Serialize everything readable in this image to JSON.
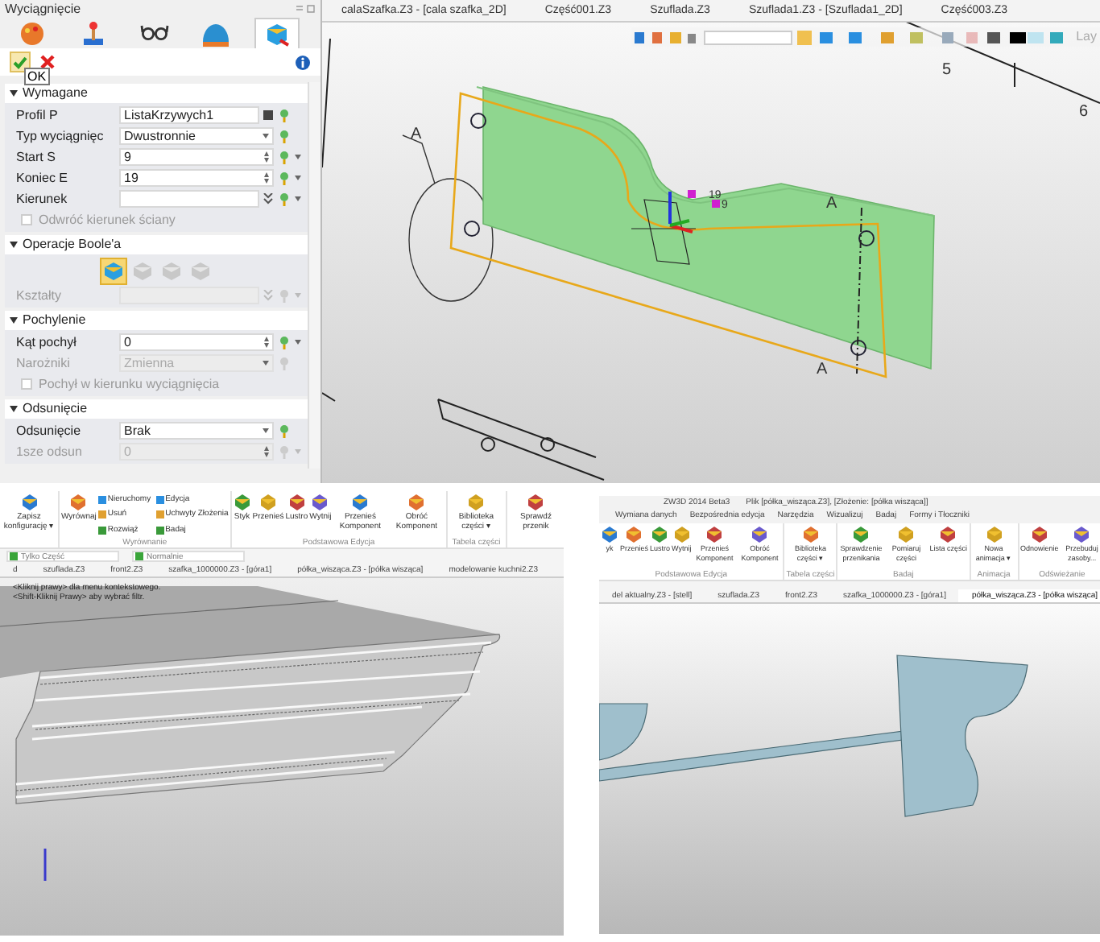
{
  "properties_panel": {
    "title": "Wyciągnięcie",
    "tabs": [
      {
        "kind": "palette",
        "selected": false
      },
      {
        "kind": "joystick",
        "selected": false
      },
      {
        "kind": "glasses",
        "selected": false
      },
      {
        "kind": "dome",
        "selected": false
      },
      {
        "kind": "cube",
        "selected": true
      }
    ],
    "tooltip": "OK",
    "sections": [
      {
        "title": "Wymagane",
        "expanded": true,
        "rows": [
          {
            "kind": "text",
            "label": "Profil P",
            "value": "ListaKrzywych1",
            "disabled": false
          },
          {
            "kind": "dropdown",
            "label": "Typ wyciągnięc",
            "value": "Dwustronnie",
            "disabled": false
          },
          {
            "kind": "spin",
            "label": "Start S",
            "value": "9",
            "disabled": false
          },
          {
            "kind": "spin",
            "label": "Koniec E",
            "value": "19",
            "disabled": false
          },
          {
            "kind": "direction",
            "label": "Kierunek",
            "disabled": false
          },
          {
            "kind": "checkbox",
            "label": "Odwróć kierunek ściany",
            "checked": false,
            "disabled": true
          }
        ]
      },
      {
        "title": "Operacje Boole'a",
        "expanded": true,
        "rows": [
          {
            "kind": "booleans",
            "options": [
              {
                "selected": true
              },
              {
                "selected": false
              },
              {
                "selected": false
              },
              {
                "selected": false
              }
            ]
          },
          {
            "kind": "direction",
            "label": "Kształty",
            "disabled": true
          }
        ]
      },
      {
        "title": "Pochylenie",
        "expanded": true,
        "rows": [
          {
            "kind": "spin",
            "label": "Kąt pochył",
            "value": "0",
            "disabled": false
          },
          {
            "kind": "dropdown",
            "label": "Narożniki",
            "value": "Zmienna",
            "disabled": true
          },
          {
            "kind": "checkbox",
            "label": "Pochył w kierunku wyciągnięcia",
            "checked": false,
            "disabled": true
          }
        ]
      },
      {
        "title": "Odsunięcie",
        "expanded": true,
        "rows": [
          {
            "kind": "dropdown",
            "label": "Odsunięcie",
            "value": "Brak",
            "disabled": false
          },
          {
            "kind": "spin",
            "label": "1sze odsun",
            "value": "0",
            "disabled": true
          }
        ]
      }
    ]
  },
  "viewport": {
    "tabs": [
      "calaSzafka.Z3 - [cala szafka_2D]",
      "Część001.Z3",
      "Szuflada.Z3",
      "Szuflada1.Z3 - [Szuflada1_2D]",
      "Część003.Z3"
    ],
    "toolbar_text": "Lay",
    "annotations": [
      "A",
      "19",
      "9",
      "A",
      "A",
      "5",
      "6"
    ]
  },
  "assembly_window": {
    "ribbon": [
      {
        "items": [
          {
            "kind": "large",
            "label": "Zapisz konfigurację ▾"
          }
        ]
      },
      {
        "label": "Wyrównanie",
        "items": [
          {
            "kind": "large",
            "label": "Wyrównaj"
          },
          {
            "kind": "small",
            "label": "Nieruchomy"
          },
          {
            "kind": "small",
            "label": "Usuń"
          },
          {
            "kind": "small",
            "label": "Rozwiąż"
          },
          {
            "kind": "small",
            "label": "Edycja"
          },
          {
            "kind": "small",
            "label": "Uchwyty Złożenia"
          },
          {
            "kind": "small",
            "label": "Badaj"
          }
        ]
      },
      {
        "label": "Podstawowa Edycja",
        "items": [
          {
            "kind": "large",
            "label": "Styk"
          },
          {
            "kind": "large",
            "label": "Przenieś"
          },
          {
            "kind": "large",
            "label": "Lustro"
          },
          {
            "kind": "large",
            "label": "Wytnij"
          },
          {
            "kind": "large",
            "label": "Przenieś Komponent"
          },
          {
            "kind": "large",
            "label": "Obróć Komponent"
          }
        ]
      },
      {
        "label": "Tabela części",
        "items": [
          {
            "kind": "large",
            "label": "Biblioteka części ▾"
          }
        ]
      },
      {
        "items": [
          {
            "kind": "large",
            "label": "Sprawdź przenik"
          }
        ]
      }
    ],
    "toolbar": [
      "Tylko Część",
      "Normalnie"
    ],
    "tabs": [
      {
        "label": "d",
        "selected": false
      },
      {
        "label": "szuflada.Z3",
        "selected": false
      },
      {
        "label": "front2.Z3",
        "selected": false
      },
      {
        "label": "szafka_1000000.Z3 - [góra1]",
        "selected": false
      },
      {
        "label": "półka_wisząca.Z3 - [półka wisząca]",
        "selected": false
      },
      {
        "label": "modelowanie kuchni2.Z3",
        "selected": false
      }
    ],
    "hints": [
      "<Kliknij prawy> dla menu kontekstowego.",
      "<Shift-Kliknij Prawy> aby wybrać filtr."
    ]
  },
  "shelf_window": {
    "title": "ZW3D 2014 Beta3",
    "file": "Plik [półka_wisząca.Z3], [Złożenie: [półka wisząca]]",
    "menu": [
      "Wymiana danych",
      "Bezpośrednia edycja",
      "Narzędzia",
      "Wizualizuj",
      "Badaj",
      "Formy i Tłoczniki"
    ],
    "ribbon": [
      {
        "label": "Podstawowa Edycja",
        "items": [
          {
            "kind": "large",
            "label": "yk"
          },
          {
            "kind": "large",
            "label": "Przenieś"
          },
          {
            "kind": "large",
            "label": "Lustro"
          },
          {
            "kind": "large",
            "label": "Wytnij"
          },
          {
            "kind": "large",
            "label": "Przenieś Komponent"
          },
          {
            "kind": "large",
            "label": "Obróć Komponent"
          }
        ]
      },
      {
        "label": "Tabela części",
        "items": [
          {
            "kind": "large",
            "label": "Biblioteka części ▾"
          }
        ]
      },
      {
        "label": "Badaj",
        "items": [
          {
            "kind": "large",
            "label": "Sprawdzenie przenikania"
          },
          {
            "kind": "large",
            "label": "Pomiaruj części"
          },
          {
            "kind": "large",
            "label": "Lista części"
          }
        ]
      },
      {
        "label": "Animacja",
        "items": [
          {
            "kind": "large",
            "label": "Nowa animacja ▾"
          }
        ]
      },
      {
        "label": "Odświeżanie",
        "items": [
          {
            "kind": "large",
            "label": "Odnowienie"
          },
          {
            "kind": "large",
            "label": "Przebuduj zasoby..."
          }
        ]
      }
    ],
    "tabs": [
      {
        "label": "del aktualny.Z3 - [stell]",
        "selected": false
      },
      {
        "label": "szuflada.Z3",
        "selected": false
      },
      {
        "label": "front2.Z3",
        "selected": false
      },
      {
        "label": "szafka_1000000.Z3 - [góra1]",
        "selected": false
      },
      {
        "label": "półka_wisząca.Z3 - [półka wisząca]",
        "selected": true
      }
    ]
  }
}
